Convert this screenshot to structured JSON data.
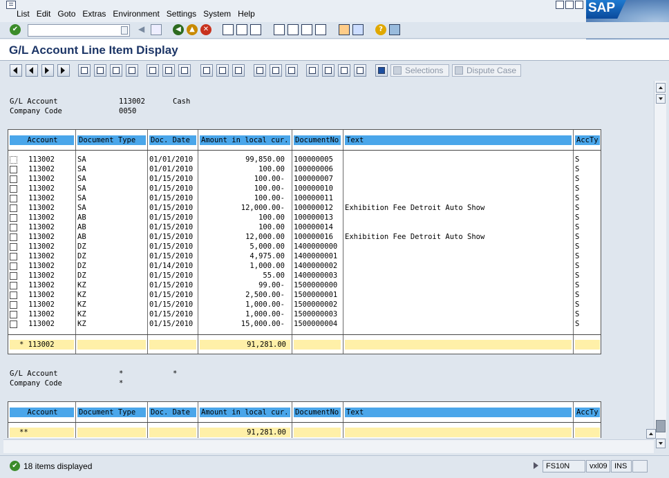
{
  "menu": [
    "List",
    "Edit",
    "Goto",
    "Extras",
    "Environment",
    "Settings",
    "System",
    "Help"
  ],
  "logo": "SAP",
  "title": "G/L Account Line Item Display",
  "buttons": {
    "selections": "Selections",
    "dispute": "Dispute Case"
  },
  "header1": {
    "gl_label": "G/L Account",
    "gl_value": "113002",
    "gl_name": "Cash",
    "cc_label": "Company Code",
    "cc_value": "0050"
  },
  "columns": [
    "Account",
    "Document Type",
    "Doc. Date",
    "Amount in local cur.",
    "DocumentNo",
    "Text",
    "AccTy"
  ],
  "rows": [
    {
      "account": "113002",
      "type": "SA",
      "date": "01/01/2010",
      "amount": "99,850.00",
      "docno": "100000005",
      "text": "",
      "accty": "S"
    },
    {
      "account": "113002",
      "type": "SA",
      "date": "01/01/2010",
      "amount": "100.00",
      "docno": "100000006",
      "text": "",
      "accty": "S"
    },
    {
      "account": "113002",
      "type": "SA",
      "date": "01/15/2010",
      "amount": "100.00-",
      "docno": "100000007",
      "text": "",
      "accty": "S"
    },
    {
      "account": "113002",
      "type": "SA",
      "date": "01/15/2010",
      "amount": "100.00-",
      "docno": "100000010",
      "text": "",
      "accty": "S"
    },
    {
      "account": "113002",
      "type": "SA",
      "date": "01/15/2010",
      "amount": "100.00-",
      "docno": "100000011",
      "text": "",
      "accty": "S"
    },
    {
      "account": "113002",
      "type": "SA",
      "date": "01/15/2010",
      "amount": "12,000.00-",
      "docno": "100000012",
      "text": "Exhibition Fee Detroit Auto Show",
      "accty": "S"
    },
    {
      "account": "113002",
      "type": "AB",
      "date": "01/15/2010",
      "amount": "100.00",
      "docno": "100000013",
      "text": "",
      "accty": "S"
    },
    {
      "account": "113002",
      "type": "AB",
      "date": "01/15/2010",
      "amount": "100.00",
      "docno": "100000014",
      "text": "",
      "accty": "S"
    },
    {
      "account": "113002",
      "type": "AB",
      "date": "01/15/2010",
      "amount": "12,000.00",
      "docno": "100000016",
      "text": "Exhibition Fee Detroit Auto Show",
      "accty": "S"
    },
    {
      "account": "113002",
      "type": "DZ",
      "date": "01/15/2010",
      "amount": "5,000.00",
      "docno": "1400000000",
      "text": "",
      "accty": "S"
    },
    {
      "account": "113002",
      "type": "DZ",
      "date": "01/15/2010",
      "amount": "4,975.00",
      "docno": "1400000001",
      "text": "",
      "accty": "S"
    },
    {
      "account": "113002",
      "type": "DZ",
      "date": "01/14/2010",
      "amount": "1,000.00",
      "docno": "1400000002",
      "text": "",
      "accty": "S"
    },
    {
      "account": "113002",
      "type": "DZ",
      "date": "01/15/2010",
      "amount": "55.00",
      "docno": "1400000003",
      "text": "",
      "accty": "S"
    },
    {
      "account": "113002",
      "type": "KZ",
      "date": "01/15/2010",
      "amount": "99.00-",
      "docno": "1500000000",
      "text": "",
      "accty": "S"
    },
    {
      "account": "113002",
      "type": "KZ",
      "date": "01/15/2010",
      "amount": "2,500.00-",
      "docno": "1500000001",
      "text": "",
      "accty": "S"
    },
    {
      "account": "113002",
      "type": "KZ",
      "date": "01/15/2010",
      "amount": "1,000.00-",
      "docno": "1500000002",
      "text": "",
      "accty": "S"
    },
    {
      "account": "113002",
      "type": "KZ",
      "date": "01/15/2010",
      "amount": "1,000.00-",
      "docno": "1500000003",
      "text": "",
      "accty": "S"
    },
    {
      "account": "113002",
      "type": "KZ",
      "date": "01/15/2010",
      "amount": "15,000.00-",
      "docno": "1500000004",
      "text": "",
      "accty": "S"
    }
  ],
  "subtotal": {
    "account": "* 113002",
    "amount": "91,281.00"
  },
  "header2": {
    "gl_label": "G/L Account",
    "gl_value": "*",
    "gl_name": "*",
    "cc_label": "Company Code",
    "cc_value": "*"
  },
  "total": {
    "account": "**",
    "amount": "91,281.00"
  },
  "status": {
    "message": "18 items displayed",
    "transaction": "FS10N",
    "system": "vxl09",
    "mode": "INS"
  }
}
